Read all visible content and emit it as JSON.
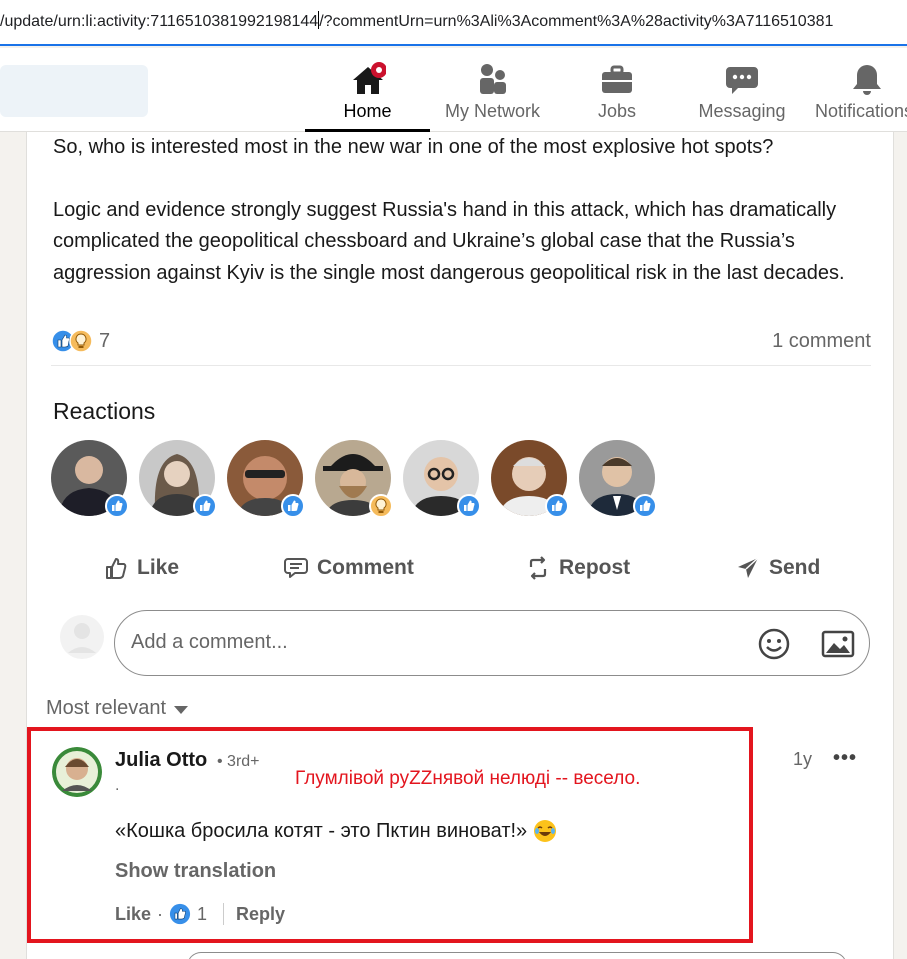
{
  "browser": {
    "url": "/update/urn:li:activity:7116510381992198144/?commentUrn=urn%3Ali%3Acomment%3A%28activity%3A7116510381"
  },
  "nav": {
    "items": [
      {
        "label": "Home",
        "icon": "home-icon",
        "active": true
      },
      {
        "label": "My Network",
        "icon": "network-icon"
      },
      {
        "label": "Jobs",
        "icon": "briefcase-icon"
      },
      {
        "label": "Messaging",
        "icon": "messaging-icon"
      },
      {
        "label": "Notifications",
        "icon": "bell-icon"
      }
    ],
    "colors": {
      "notification_dot": "#cb112d",
      "accent": "#0a66c2"
    }
  },
  "post": {
    "paragraphs": [
      "So, who is interested most in the new war in one of the most explosive hot spots?",
      "Logic and evidence strongly suggest Russia's hand in this attack, which has dramatically complicated the geopolitical chessboard and Ukraine’s global case that the Russia’s aggression against Kyiv is the single most dangerous geopolitical risk in the last decades."
    ],
    "reaction_count": "7",
    "comment_count": "1 comment"
  },
  "reactions": {
    "title": "Reactions",
    "avatars": [
      {
        "icon": "like-icon"
      },
      {
        "icon": "like-icon"
      },
      {
        "icon": "like-icon"
      },
      {
        "icon": "insightful-icon"
      },
      {
        "icon": "like-icon"
      },
      {
        "icon": "like-icon"
      },
      {
        "icon": "like-icon"
      }
    ]
  },
  "actions": {
    "like": "Like",
    "comment": "Comment",
    "repost": "Repost",
    "send": "Send"
  },
  "comment_box": {
    "placeholder": "Add a comment..."
  },
  "sort": {
    "label": "Most relevant"
  },
  "comment": {
    "author": "Julia Otto",
    "degree": "• 3rd+",
    "subtitle": ".",
    "time": "1y",
    "more": "•••",
    "text": "«Кошка бросила котят - это Пктин виноват!»",
    "show_translation": "Show translation",
    "like": "Like",
    "dot": "·",
    "like_count": "1",
    "reply": "Reply"
  },
  "annotation": {
    "text": "Глумлівой руZZнявой нелюді -- весело.",
    "color": "#e3151e"
  }
}
